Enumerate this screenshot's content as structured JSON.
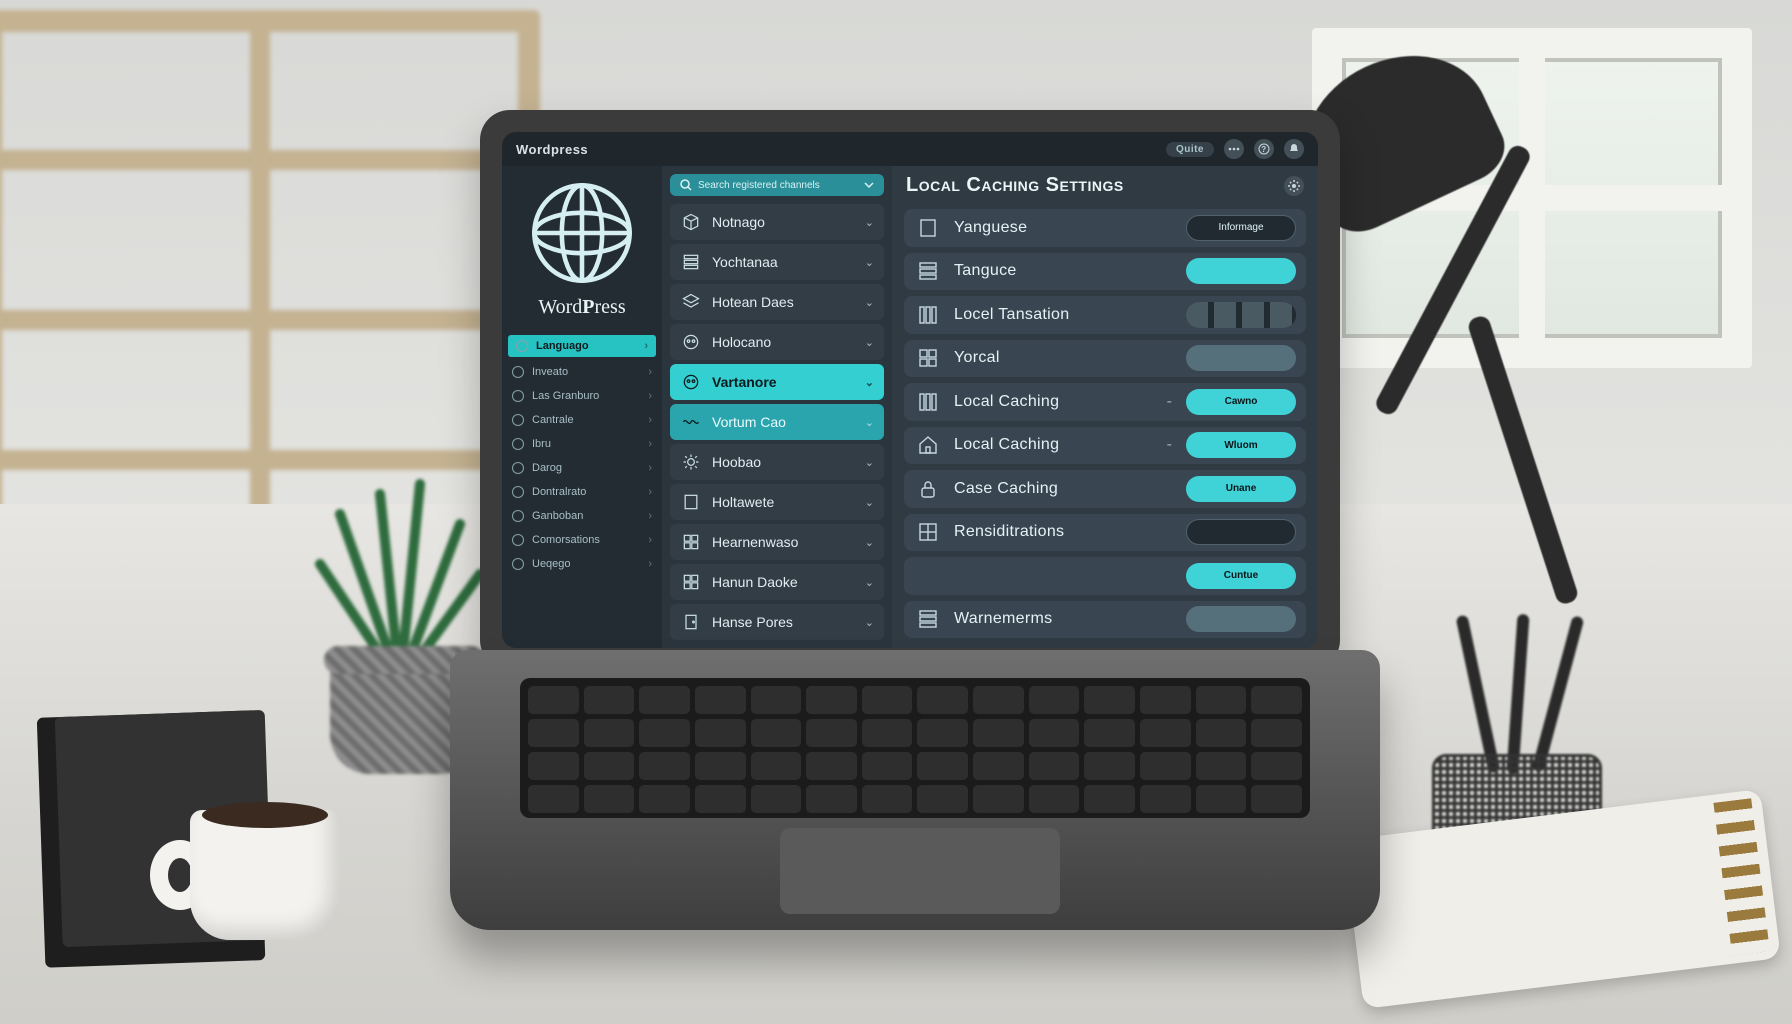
{
  "topbar": {
    "title": "Wordpress",
    "badge": "Quite",
    "icons": [
      "dots-icon",
      "help-icon",
      "bell-icon"
    ]
  },
  "brand": {
    "prefix": "Word",
    "bold": "P",
    "suffix": "ress"
  },
  "sidebar": {
    "items": [
      {
        "label": "Languago",
        "active": true
      },
      {
        "label": "Inveato"
      },
      {
        "label": "Las Granburo"
      },
      {
        "label": "Cantrale"
      },
      {
        "label": "Ibru"
      },
      {
        "label": "Darog"
      },
      {
        "label": "Dontralrato"
      },
      {
        "label": "Ganboban"
      },
      {
        "label": "Comorsations"
      },
      {
        "label": "Ueqego"
      }
    ]
  },
  "menu2": {
    "search_placeholder": "Search registered channels",
    "items": [
      {
        "label": "Notnago",
        "icon": "cube-icon"
      },
      {
        "label": "Yochtanaa",
        "icon": "stack-icon"
      },
      {
        "label": "Hotean Daes",
        "icon": "layers-icon"
      },
      {
        "label": "Holocano",
        "icon": "mask-icon"
      },
      {
        "label": "Vartanore",
        "icon": "mask-icon",
        "sel": "sel"
      },
      {
        "label": "Vortum Cao",
        "icon": "wave-icon",
        "sel": "sel2"
      },
      {
        "label": "Hoobao",
        "icon": "gear-icon"
      },
      {
        "label": "Holtawete",
        "icon": "building-icon"
      },
      {
        "label": "Hearnenwaso",
        "icon": "grid-icon"
      },
      {
        "label": "Hanun Daoke",
        "icon": "grid-icon"
      },
      {
        "label": "Hanse Pores",
        "icon": "door-icon"
      }
    ]
  },
  "panel": {
    "title": "Local Caching Settings",
    "rows": [
      {
        "label": "Yanguese",
        "icon": "building-icon",
        "value": "Informage",
        "style": "pill-dark"
      },
      {
        "label": "Tanguce",
        "icon": "stack-icon",
        "value": "",
        "style": "pill-accent"
      },
      {
        "label": "Locel Tansation",
        "icon": "columns-icon",
        "value": "",
        "style": "bar"
      },
      {
        "label": "Yorcal",
        "icon": "grid-icon",
        "value": "",
        "style": "pill-soft"
      },
      {
        "label": "Local Caching",
        "icon": "columns-icon",
        "value": "Cawno",
        "style": "pill-accent",
        "dash": true
      },
      {
        "label": "Local Caching",
        "icon": "house-icon",
        "value": "Wluom",
        "style": "pill-accent",
        "dash": true
      },
      {
        "label": "Case Caching",
        "icon": "lock-icon",
        "value": "Unane",
        "style": "pill-accent"
      },
      {
        "label": "Rensiditrations",
        "icon": "grid4-icon",
        "value": "",
        "style": "pill-dark"
      },
      {
        "label": "",
        "icon": "",
        "value": "Cuntue",
        "style": "pill-accent"
      },
      {
        "label": "Warnemerms",
        "icon": "stack-icon",
        "value": "",
        "style": "pill-soft"
      }
    ]
  }
}
